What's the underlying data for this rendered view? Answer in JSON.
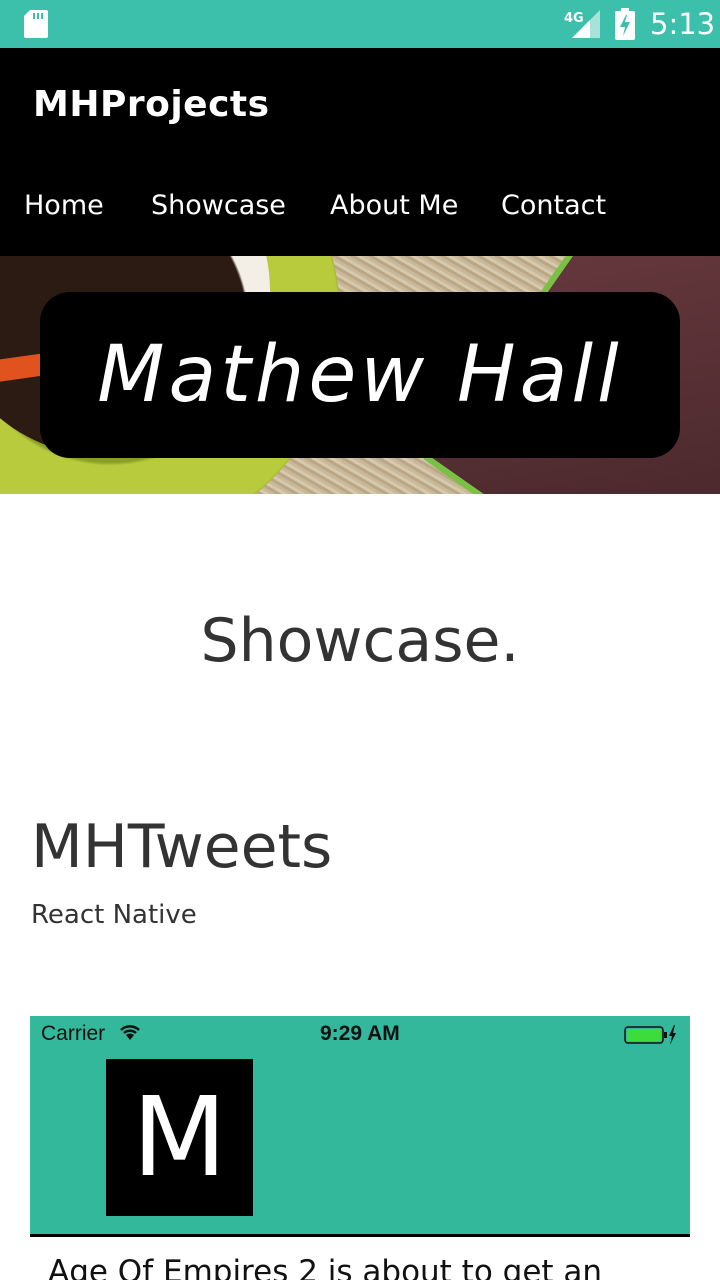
{
  "status_bar": {
    "time": "5:13",
    "network": "4G",
    "icons": [
      "sd-card-icon",
      "cell-signal-icon",
      "battery-charging-icon"
    ]
  },
  "app_bar": {
    "brand": "MHProjects",
    "nav": [
      {
        "label": "Home"
      },
      {
        "label": "Showcase"
      },
      {
        "label": "About Me"
      },
      {
        "label": "Contact"
      }
    ]
  },
  "hero": {
    "name": "Mathew Hall"
  },
  "main": {
    "section_title": "Showcase.",
    "project": {
      "title": "MHTweets",
      "tech": "React Native",
      "screenshot": {
        "carrier": "Carrier",
        "time": "9:29 AM",
        "logo_letter": "M",
        "tweet_text": "Age Of Empires 2 is about to get an"
      }
    }
  },
  "colors": {
    "status_bar": "#3cc0ac",
    "app_bar": "#000000",
    "screenshot_header": "#33b89b",
    "text_dark": "#333333"
  }
}
